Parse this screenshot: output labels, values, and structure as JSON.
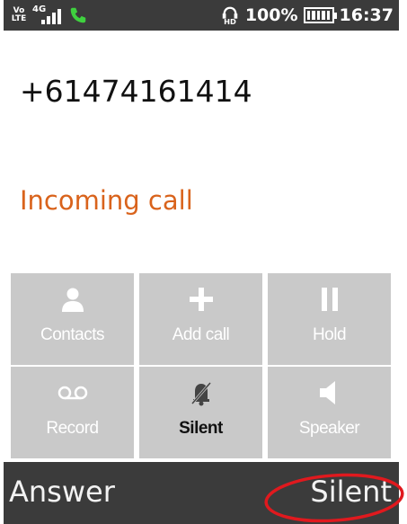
{
  "status_bar": {
    "volte": "Vo LTE",
    "network": "4G",
    "signal_level": 4,
    "battery_percent": "100%",
    "battery_level": 1.0,
    "time": "16:37",
    "colors": {
      "background": "#3b3b3b",
      "call_icon": "#3fd13f"
    }
  },
  "call": {
    "number": "+61474161414",
    "state": "Incoming call",
    "state_color": "#d9631c"
  },
  "actions": [
    {
      "label": "Contacts",
      "icon": "person-icon",
      "active": false
    },
    {
      "label": "Add call",
      "icon": "plus-icon",
      "active": false
    },
    {
      "label": "Hold",
      "icon": "pause-icon",
      "active": false
    },
    {
      "label": "Record",
      "icon": "voicemail-icon",
      "active": false
    },
    {
      "label": "Silent",
      "icon": "mute-icon",
      "active": true
    },
    {
      "label": "Speaker",
      "icon": "speaker-icon",
      "active": false
    }
  ],
  "softkeys": {
    "left": "Answer",
    "right": "Silent"
  },
  "annotation": {
    "color": "#e0191e",
    "shape": "circle around right softkey"
  }
}
